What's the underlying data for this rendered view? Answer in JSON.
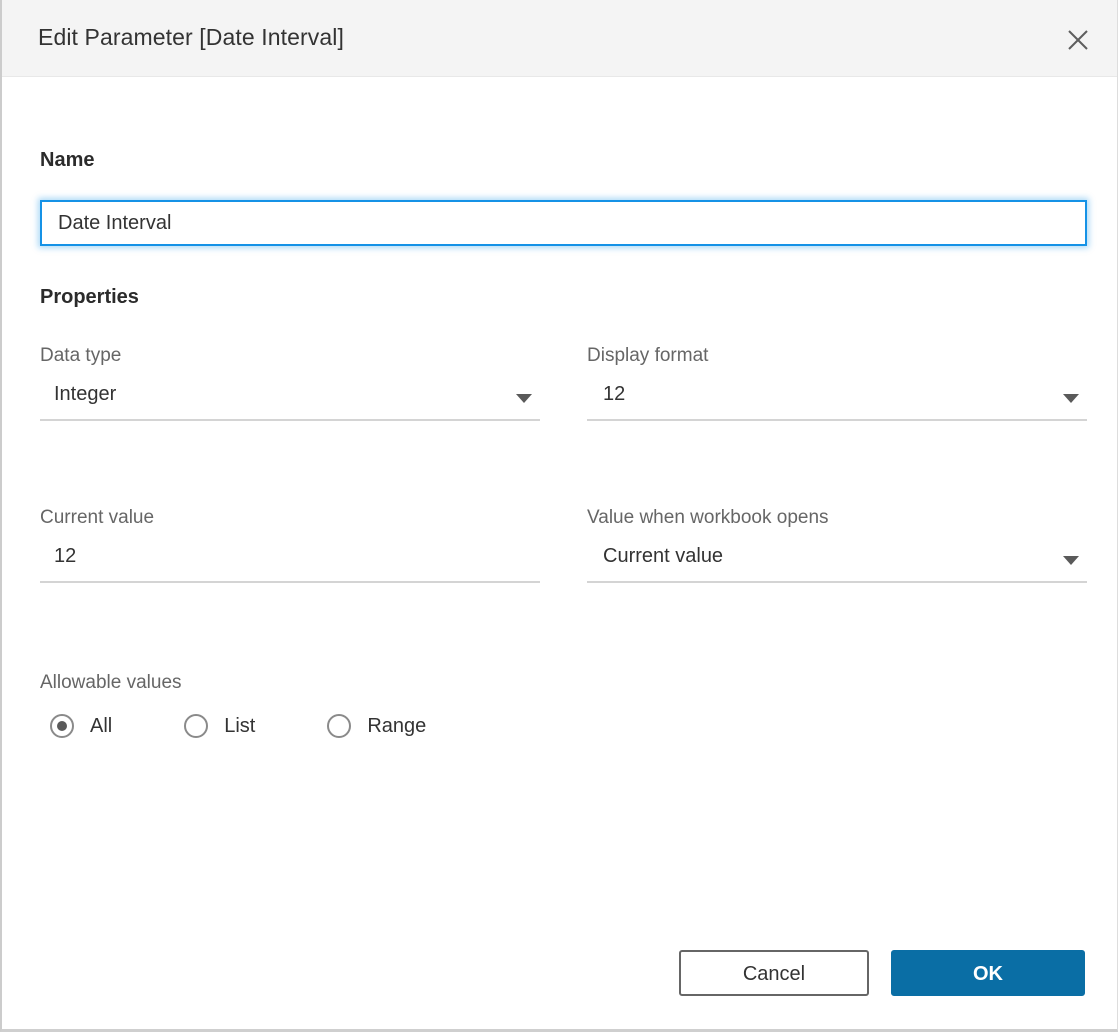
{
  "dialog": {
    "title": "Edit Parameter [Date Interval]",
    "close_icon": "close-icon"
  },
  "name_section": {
    "heading": "Name",
    "value": "Date Interval",
    "placeholder": "Name"
  },
  "properties_section": {
    "heading": "Properties",
    "fields": [
      {
        "label": "Data type",
        "value": "Integer",
        "kind": "select"
      },
      {
        "label": "Display format",
        "value": "12",
        "kind": "select"
      },
      {
        "label": "Current value",
        "value": "12",
        "kind": "text"
      },
      {
        "label": "Value when workbook opens",
        "value": "Current value",
        "kind": "select"
      }
    ]
  },
  "allowable_values": {
    "label": "Allowable values",
    "options": [
      {
        "label": "All",
        "selected": true
      },
      {
        "label": "List",
        "selected": false
      },
      {
        "label": "Range",
        "selected": false
      }
    ]
  },
  "footer": {
    "cancel_label": "Cancel",
    "ok_label": "OK"
  },
  "colors": {
    "primary": "#0a6ea5",
    "focus_border": "#1592e6",
    "titlebar_bg": "#f4f4f4",
    "label_text": "#666666",
    "value_text": "#333333"
  }
}
